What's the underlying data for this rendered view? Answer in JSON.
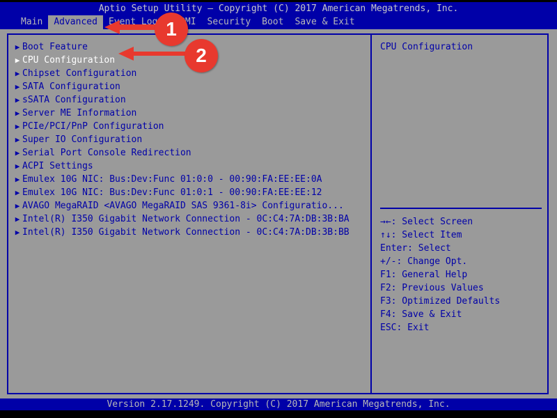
{
  "window": {
    "title": "Aptio Setup Utility – Copyright (C) 2017 American Megatrends, Inc.",
    "version_bar": "Version 2.17.1249. Copyright (C) 2017 American Megatrends, Inc."
  },
  "menubar": {
    "tabs": [
      {
        "label": "Main",
        "active": false
      },
      {
        "label": "Advanced",
        "active": true
      },
      {
        "label": "Event Logs",
        "active": false
      },
      {
        "label": "IPMI",
        "active": false
      },
      {
        "label": "Security",
        "active": false
      },
      {
        "label": "Boot",
        "active": false
      },
      {
        "label": "Save & Exit",
        "active": false
      }
    ]
  },
  "main": {
    "items": [
      {
        "arrow": "▶",
        "label": "Boot Feature",
        "selected": false
      },
      {
        "arrow": "▶",
        "label": "CPU Configuration",
        "selected": true
      },
      {
        "arrow": "▶",
        "label": "Chipset Configuration",
        "selected": false
      },
      {
        "arrow": "▶",
        "label": "SATA Configuration",
        "selected": false
      },
      {
        "arrow": "▶",
        "label": "sSATA Configuration",
        "selected": false
      },
      {
        "arrow": "▶",
        "label": "Server ME Information",
        "selected": false
      },
      {
        "arrow": "▶",
        "label": "PCIe/PCI/PnP Configuration",
        "selected": false
      },
      {
        "arrow": "▶",
        "label": "Super IO Configuration",
        "selected": false
      },
      {
        "arrow": "▶",
        "label": "Serial Port Console Redirection",
        "selected": false
      },
      {
        "arrow": "▶",
        "label": "ACPI Settings",
        "selected": false
      },
      {
        "arrow": "▶",
        "label": "Emulex 10G NIC: Bus:Dev:Func 01:0:0 - 00:90:FA:EE:EE:0A",
        "selected": false
      },
      {
        "arrow": "▶",
        "label": "Emulex 10G NIC: Bus:Dev:Func 01:0:1 - 00:90:FA:EE:EE:12",
        "selected": false
      },
      {
        "arrow": "▶",
        "label": "AVAGO MegaRAID <AVAGO MegaRAID SAS 9361-8i> Configuratio...",
        "selected": false
      },
      {
        "arrow": "▶",
        "label": "Intel(R) I350 Gigabit Network Connection - 0C:C4:7A:DB:3B:BA",
        "selected": false
      },
      {
        "arrow": "▶",
        "label": "Intel(R) I350 Gigabit Network Connection - 0C:C4:7A:DB:3B:BB",
        "selected": false
      }
    ]
  },
  "help": {
    "description": "CPU Configuration",
    "keys": [
      "→←: Select Screen",
      "↑↓: Select Item",
      "Enter: Select",
      "+/-: Change Opt.",
      "F1: General Help",
      "F2: Previous Values",
      "F3: Optimized Defaults",
      "F4: Save & Exit",
      "ESC: Exit"
    ]
  },
  "annotations": [
    {
      "number": "1",
      "target": "Advanced"
    },
    {
      "number": "2",
      "target": "CPU Configuration"
    }
  ],
  "colors": {
    "background": "#9a9a9a",
    "blue": "#0000a8",
    "text_blue": "#0000a8",
    "text_light": "#c8c8c8",
    "selected_text": "#ffffff",
    "annotation_red": "#e8392e"
  }
}
